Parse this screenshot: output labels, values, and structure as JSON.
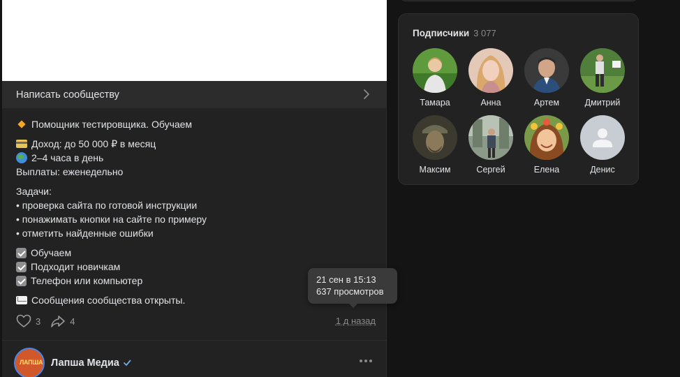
{
  "post": {
    "write_label": "Написать сообществу",
    "lines": {
      "l1": "Помощник тестировщика. Обучаем",
      "l2": "Доход: до 50 000 ₽ в месяц",
      "l3": "2–4 часа в день",
      "l4": "Выплаты: еженедельно",
      "l5": "Задачи:",
      "l6": "• проверка сайта по готовой инструкции",
      "l7": "• понажимать кнопки на сайте по примеру",
      "l8": "• отметить найденные ошибки",
      "l9": "Обучаем",
      "l10": "Подходит новичкам",
      "l11": "Телефон или компьютер",
      "l12": "Сообщения сообщества открыты."
    },
    "likes": "3",
    "shares": "4",
    "time_ago": "1 д назад",
    "tooltip": {
      "date": "21 сен в 15:13",
      "views": "637 просмотров"
    }
  },
  "next_post": {
    "author": "Лапша Медиа",
    "logo_text": "ЛАПША"
  },
  "subscribers": {
    "title": "Подписчики",
    "count": "3 077",
    "people": [
      {
        "name": "Тамара"
      },
      {
        "name": "Анна"
      },
      {
        "name": "Артем"
      },
      {
        "name": "Дмитрий"
      },
      {
        "name": "Максим"
      },
      {
        "name": "Сергей"
      },
      {
        "name": "Елена"
      },
      {
        "name": "Денис"
      }
    ]
  },
  "icons": {
    "chevron": "chevron-right-icon",
    "like": "heart-icon",
    "share": "share-arrow-icon",
    "more": "more-dots-icon",
    "verified": "verified-check-icon"
  }
}
